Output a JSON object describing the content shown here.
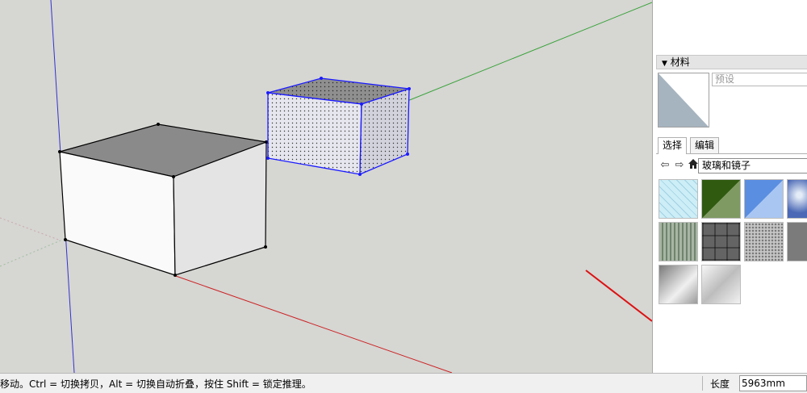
{
  "status_bar": {
    "hint": "移动。Ctrl = 切换拷贝，Alt = 切换自动折叠，按住 Shift = 锁定推理。",
    "length_label": "长度",
    "length_value": "5963mm"
  },
  "materials_panel": {
    "title": "材料",
    "material_name_placeholder": "预设",
    "tabs": [
      {
        "label": "选择",
        "active": true
      },
      {
        "label": "编辑",
        "active": false
      }
    ],
    "collection": "玻璃和镜子",
    "swatches": [
      {
        "name": "glass-grid-swatch",
        "color": "#bfe5f0"
      },
      {
        "name": "green-glass-swatch",
        "color": "#3f6a1e"
      },
      {
        "name": "blue-glass-swatch",
        "color": "#6f9fe8"
      },
      {
        "name": "sky-reflection-swatch",
        "color": "#6b86c8"
      },
      {
        "name": "green-fluted-glass-swatch",
        "color": "#8fa18c"
      },
      {
        "name": "stone-tile-swatch",
        "color": "#8a8a8a"
      },
      {
        "name": "frosted-glass-swatch",
        "color": "#bcbcbc"
      },
      {
        "name": "grey-partial-swatch",
        "color": "#7b7b7b"
      },
      {
        "name": "mirror-swatch",
        "color": "#b0b0b0"
      },
      {
        "name": "silver-mirror-swatch",
        "color": "#d2d2d2"
      }
    ]
  },
  "colors": {
    "viewport_bg": "#d6d6d3",
    "selection": "#1a1aff",
    "axis_red": "#cc2222",
    "axis_green": "#3aa33a",
    "axis_blue": "#3333cc",
    "arrow": "#dd1111"
  }
}
